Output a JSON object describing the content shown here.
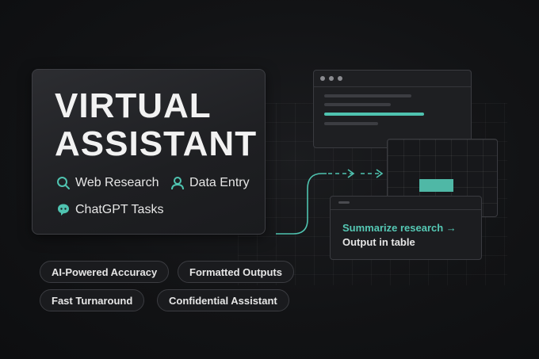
{
  "hero": {
    "title_line1": "VIRTUAL",
    "title_line2": "ASSISTANT",
    "services": [
      {
        "label": "Web Research",
        "icon": "search-icon"
      },
      {
        "label": "Data Entry",
        "icon": "user-icon"
      },
      {
        "label": "ChatGPT Tasks",
        "icon": "chatbot-icon"
      }
    ]
  },
  "pills": [
    "AI-Powered Accuracy",
    "Formatted Outputs",
    "Fast Turnaround",
    "Confidential Assistant"
  ],
  "prompt_window": {
    "line1": "Summarize research →",
    "line2": "Output in table"
  },
  "colors": {
    "accent": "#4fc3b0",
    "background": "#121315",
    "card": "#242529",
    "text": "#f2f2f2"
  }
}
